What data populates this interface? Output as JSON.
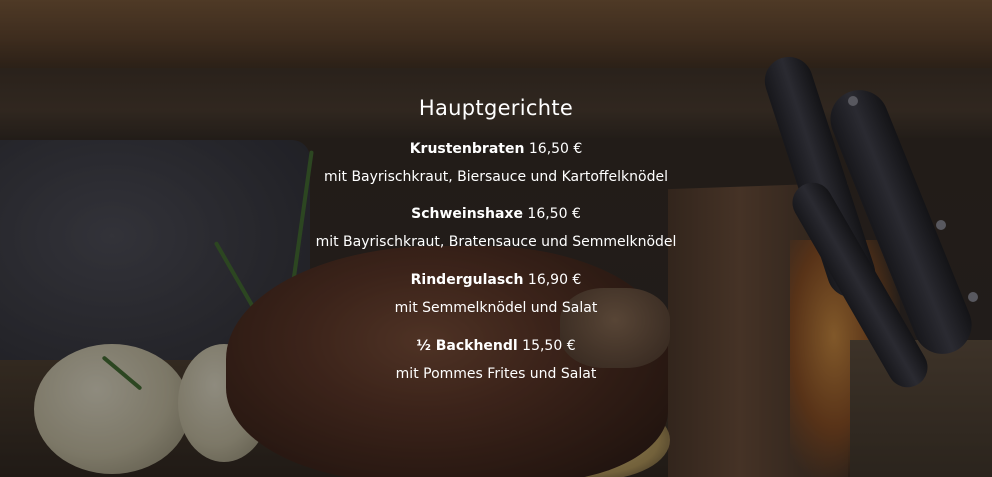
{
  "section": {
    "title": "Hauptgerichte"
  },
  "dishes": [
    {
      "name": "Krustenbraten",
      "price": "16,50 €",
      "description": "mit Bayrischkraut, Biersauce und Kartoffelknödel"
    },
    {
      "name": "Schweinshaxe",
      "price": "16,50 €",
      "description": "mit Bayrischkraut, Bratensauce und Semmelknödel"
    },
    {
      "name": "Rindergulasch",
      "price": "16,90 €",
      "description": "mit Semmelknödel und Salat"
    },
    {
      "name": "½ Backhendl",
      "price": "15,50 €",
      "description": "mit Pommes Frites und Salat"
    }
  ],
  "colors": {
    "text": "#ffffff",
    "background_tint": "#2a2420"
  }
}
